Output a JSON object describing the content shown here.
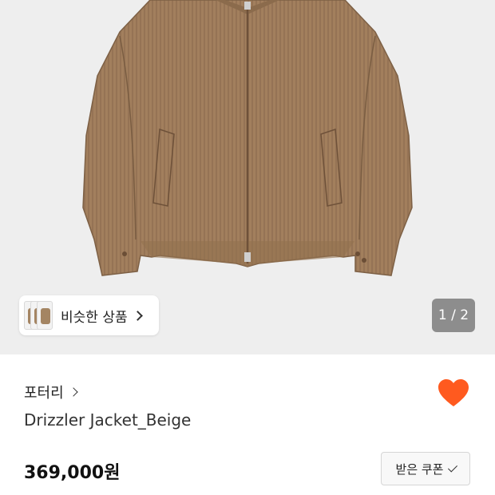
{
  "gallery": {
    "similar_label": "비슷한 상품",
    "counter": "1 / 2",
    "image_icon": "jacket-photo"
  },
  "product": {
    "brand": "포터리",
    "title": "Drizzler Jacket_Beige",
    "price": "369,000원",
    "coupon_label": "받은 쿠폰",
    "liked": true
  },
  "colors": {
    "heart": "#ff5a1f",
    "jacket": "#a27f5d",
    "hero_bg": "#eeeeee"
  }
}
